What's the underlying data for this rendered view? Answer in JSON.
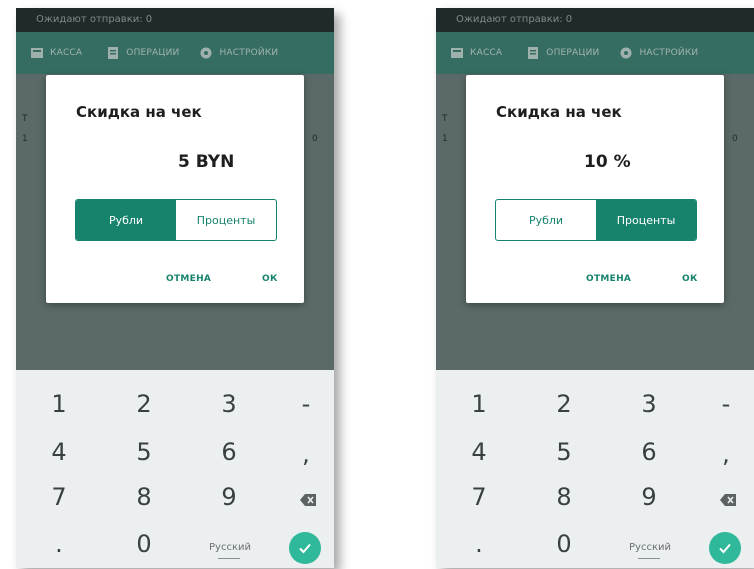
{
  "status_bar": {
    "text": "Ожидают отправки: 0"
  },
  "tabs": [
    {
      "label": "КАССА",
      "icon": "register-icon"
    },
    {
      "label": "ОПЕРАЦИИ",
      "icon": "operations-icon"
    },
    {
      "label": "НАСТРОЙКИ",
      "icon": "gear-icon"
    }
  ],
  "background_fragments": {
    "t_letter": "Т",
    "one_digit": "1",
    "zero_digit": "0"
  },
  "screens": [
    {
      "dialog": {
        "title": "Скидка на чек",
        "value": "5 BYN",
        "toggle": {
          "options": [
            "Рубли",
            "Проценты"
          ],
          "selected": "Рубли"
        },
        "cancel": "ОТМЕНА",
        "ok": "ОК"
      }
    },
    {
      "dialog": {
        "title": "Скидка на чек",
        "value": "10 %",
        "toggle": {
          "options": [
            "Рубли",
            "Проценты"
          ],
          "selected": "Проценты"
        },
        "cancel": "ОТМЕНА",
        "ok": "ОК"
      }
    }
  ],
  "keyboard": {
    "row1": [
      "1",
      "2",
      "3",
      "-"
    ],
    "row2": [
      "4",
      "5",
      "6",
      ","
    ],
    "row3": [
      "7",
      "8",
      "9"
    ],
    "row4": [
      ".",
      "0"
    ],
    "language": "Русский",
    "backspace_icon": "backspace-icon",
    "enter_icon": "check-icon"
  },
  "colors": {
    "accent": "#17836d",
    "check": "#2fb89a",
    "status_bar": "#1f2b2a"
  }
}
